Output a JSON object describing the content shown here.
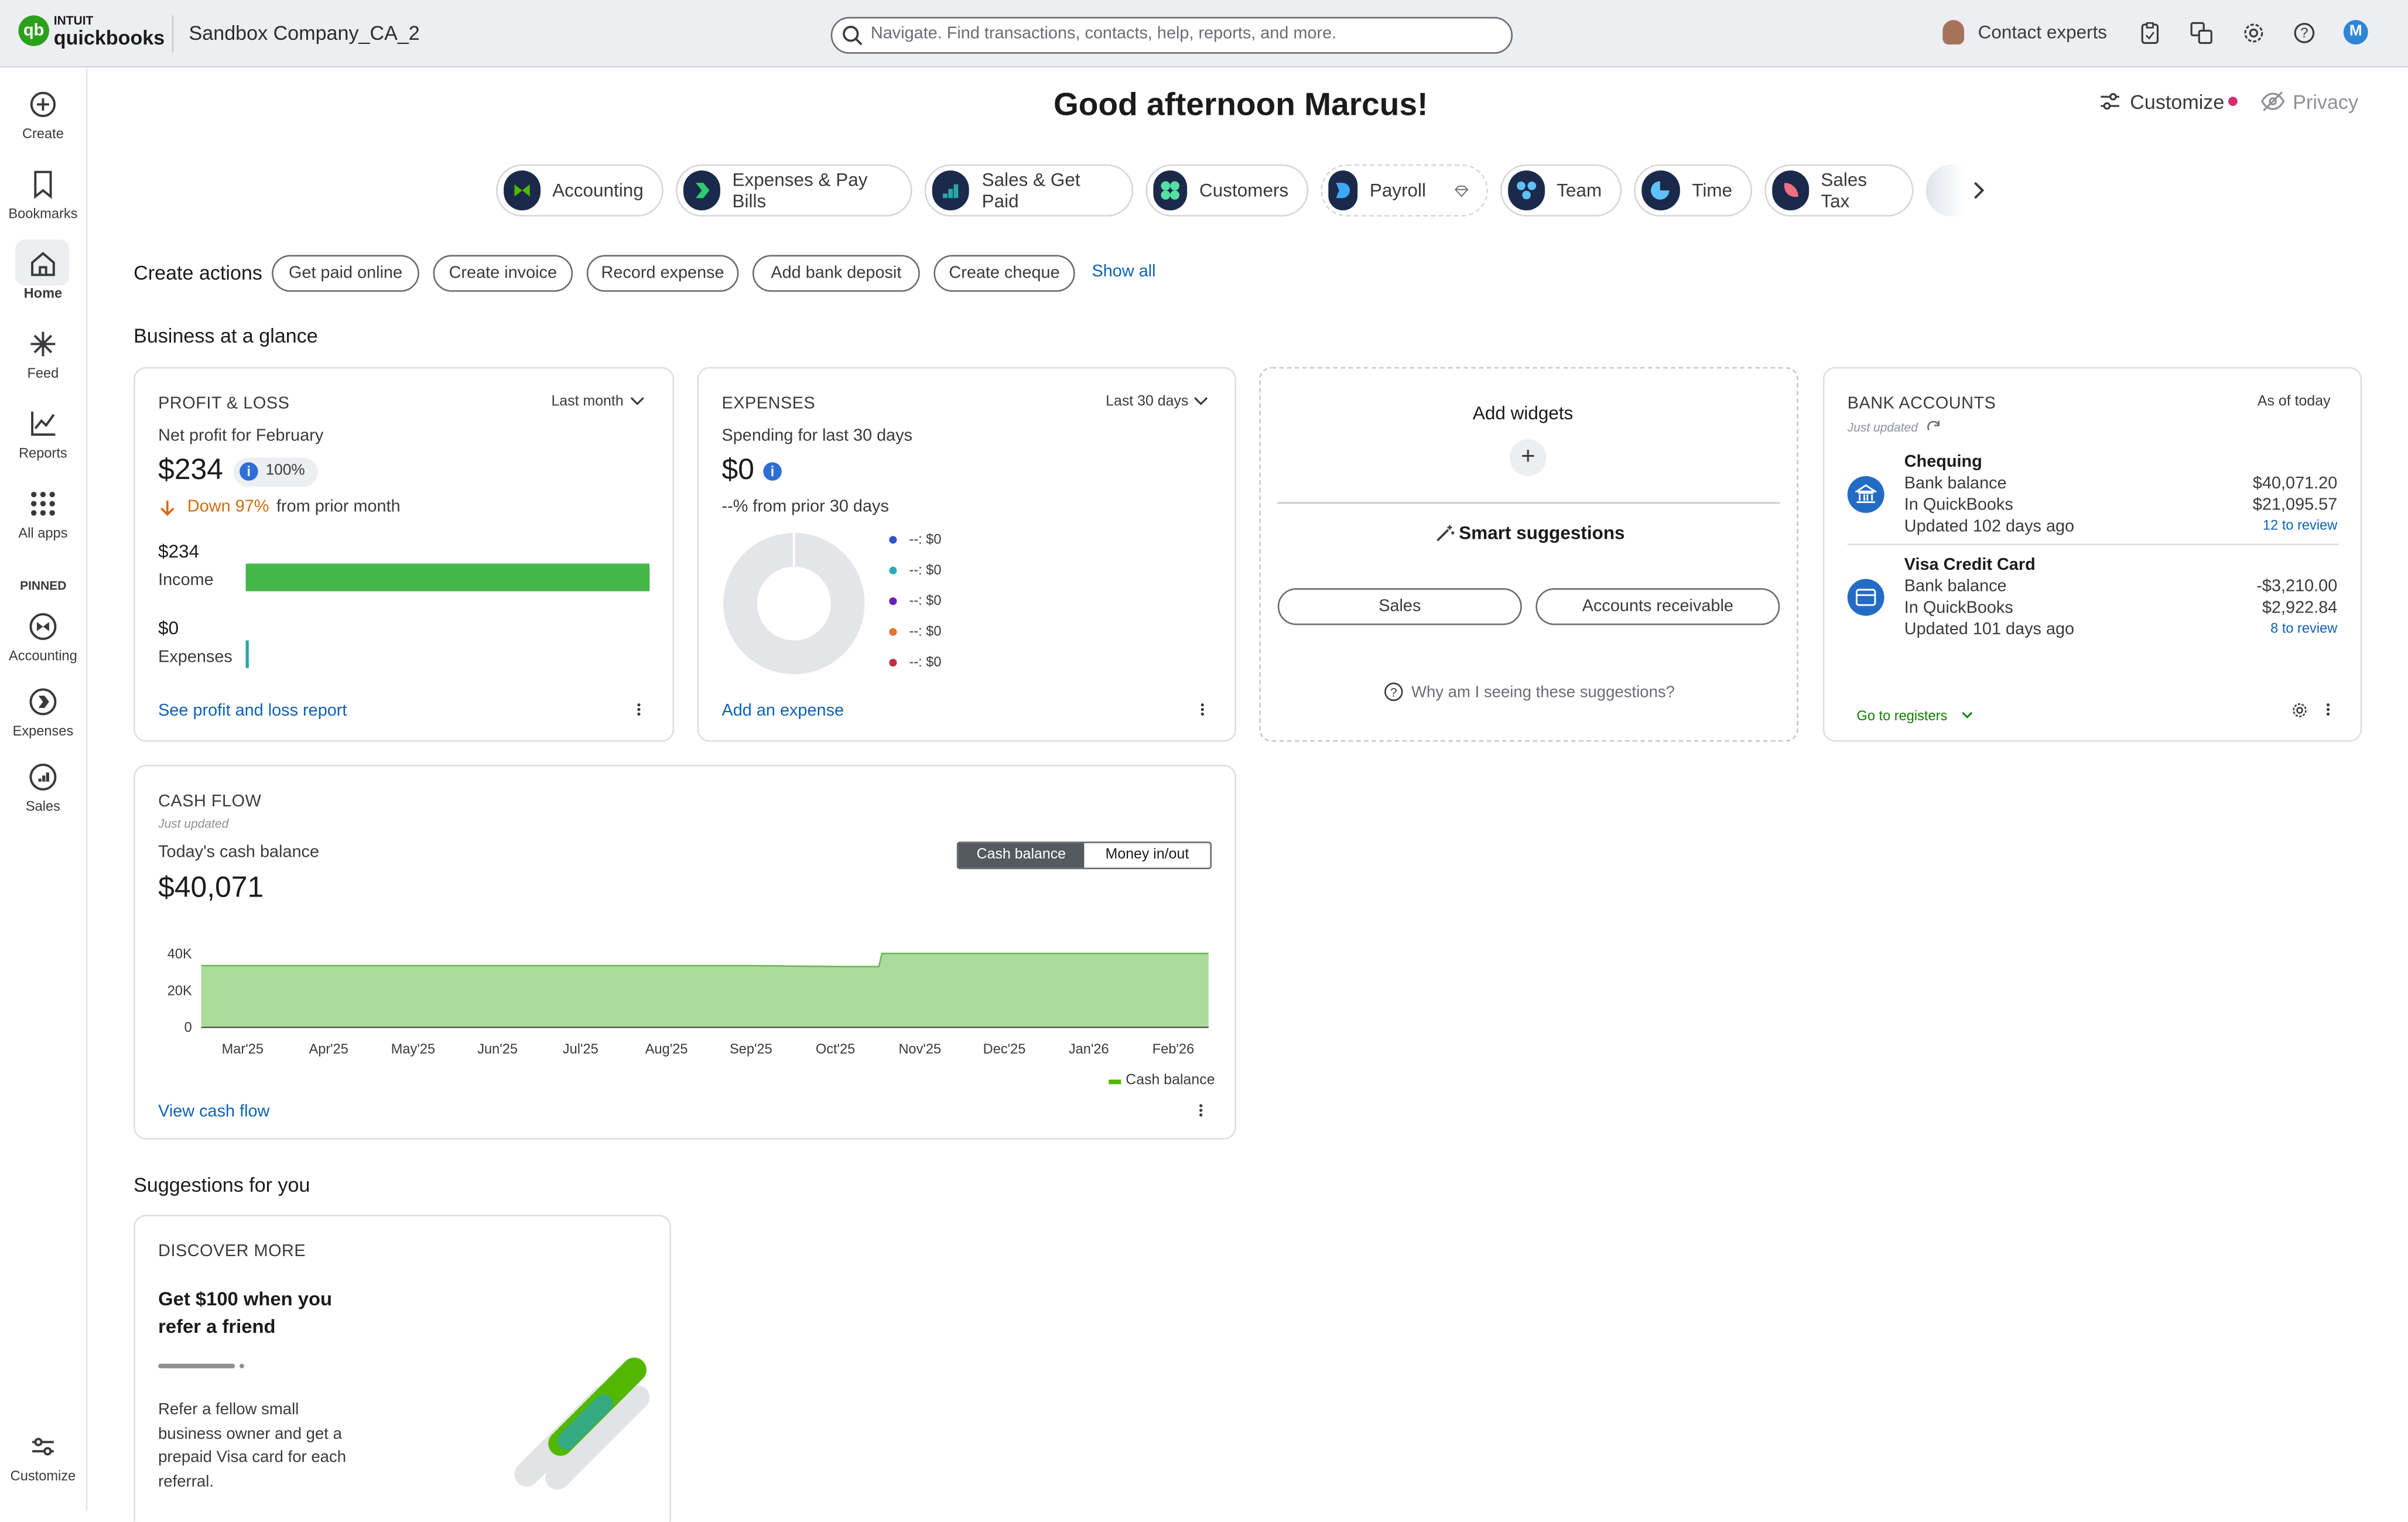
{
  "brand": {
    "logo_top": "INTUIT",
    "logo_bottom": "quickbooks",
    "company": "Sandbox Company_CA_2"
  },
  "search": {
    "placeholder": "Navigate. Find transactions, contacts, help, reports, and more."
  },
  "topbar": {
    "contact_experts": "Contact experts",
    "avatar_initial": "M"
  },
  "sidebar": {
    "items": [
      {
        "label": "Create",
        "icon": "plus-circle-icon"
      },
      {
        "label": "Bookmarks",
        "icon": "bookmark-icon"
      },
      {
        "label": "Home",
        "icon": "home-icon"
      },
      {
        "label": "Feed",
        "icon": "sparkle-icon"
      },
      {
        "label": "Reports",
        "icon": "line-chart-icon"
      },
      {
        "label": "All apps",
        "icon": "grid-icon"
      }
    ],
    "pinned_label": "PINNED",
    "pinned": [
      {
        "label": "Accounting",
        "icon": "accounting-icon"
      },
      {
        "label": "Expenses",
        "icon": "expenses-icon"
      },
      {
        "label": "Sales",
        "icon": "sales-icon"
      }
    ],
    "customize": "Customize"
  },
  "header": {
    "greeting": "Good afternoon Marcus!",
    "customize": "Customize",
    "privacy": "Privacy"
  },
  "apps": [
    "Accounting",
    "Expenses & Pay Bills",
    "Sales & Get Paid",
    "Customers",
    "Payroll",
    "Team",
    "Time",
    "Sales Tax"
  ],
  "create_actions": {
    "label": "Create actions",
    "chips": [
      "Get paid online",
      "Create invoice",
      "Record expense",
      "Add bank deposit",
      "Create cheque"
    ],
    "show_all": "Show all"
  },
  "glance_title": "Business at a glance",
  "profit_loss": {
    "title": "PROFIT & LOSS",
    "period": "Last month",
    "subtitle": "Net profit for February",
    "amount": "$234",
    "pct": "100%",
    "change": "Down 97%",
    "change_suffix": "from prior month",
    "income_amount": "$234",
    "income_label": "Income",
    "income_fraction": 1.0,
    "expenses_amount": "$0",
    "expenses_label": "Expenses",
    "expenses_fraction": 0.0,
    "link": "See profit and loss report"
  },
  "expenses": {
    "title": "EXPENSES",
    "period": "Last 30 days",
    "subtitle": "Spending for last 30 days",
    "amount": "$0",
    "change": "--% from prior 30 days",
    "legend": [
      "--: $0",
      "--: $0",
      "--: $0",
      "--: $0",
      "--: $0"
    ],
    "legend_colors": [
      "#2f54c2",
      "#2ea8b6",
      "#6b1fb8",
      "#e2733a",
      "#b8333e"
    ],
    "link": "Add an expense"
  },
  "widgets": {
    "title": "Add widgets",
    "smart": "Smart suggestions",
    "btn_sales": "Sales",
    "btn_ar": "Accounts receivable",
    "why": "Why am I seeing these suggestions?"
  },
  "bank": {
    "title": "BANK ACCOUNTS",
    "as_of": "As of today",
    "updated": "Just updated",
    "accounts": [
      {
        "name": "Chequing",
        "bank_label": "Bank balance",
        "bank_value": "$40,071.20",
        "qb_label": "In QuickBooks",
        "qb_value": "$21,095.57",
        "updated": "Updated 102 days ago",
        "review": "12 to review"
      },
      {
        "name": "Visa Credit Card",
        "bank_label": "Bank balance",
        "bank_value": "-$3,210.00",
        "qb_label": "In QuickBooks",
        "qb_value": "$2,922.84",
        "updated": "Updated 101 days ago",
        "review": "8 to review"
      }
    ],
    "link": "Go to registers"
  },
  "cashflow": {
    "title": "CASH FLOW",
    "updated": "Just updated",
    "subtitle": "Today's cash balance",
    "amount": "$40,071",
    "toggle_a": "Cash balance",
    "toggle_b": "Money in/out",
    "legend": "Cash balance",
    "link": "View cash flow"
  },
  "chart_data": {
    "type": "area",
    "title": "",
    "x": [
      "Mar'25",
      "Apr'25",
      "May'25",
      "Jun'25",
      "Jul'25",
      "Aug'25",
      "Sep'25",
      "Oct'25",
      "Nov'25",
      "Dec'25",
      "Jan'26",
      "Feb'26"
    ],
    "y_ticks": [
      "40K",
      "20K",
      "0"
    ],
    "ylim": [
      0,
      40000
    ],
    "series": [
      {
        "name": "Cash balance",
        "values": [
          33500,
          33500,
          33500,
          33500,
          33500,
          33500,
          33500,
          33000,
          40071,
          40071,
          40071,
          40071
        ]
      }
    ],
    "color": "#8fd07b",
    "legend_position": "bottom-right",
    "grid": false
  },
  "suggestions": {
    "title": "Suggestions for you",
    "card_title": "DISCOVER MORE",
    "headline": "Get $100 when you refer a friend",
    "body": "Refer a fellow small business owner and get a prepaid Visa card for each referral."
  }
}
